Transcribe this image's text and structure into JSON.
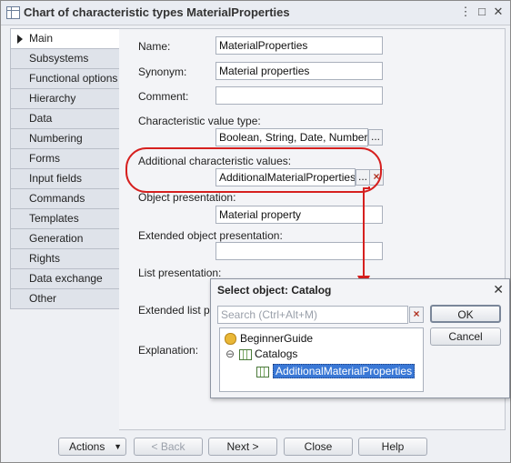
{
  "window": {
    "title": "Chart of characteristic types MaterialProperties",
    "controls": [
      "⋮",
      "□",
      "✕"
    ]
  },
  "tabs": [
    {
      "label": "Main",
      "active": true
    },
    {
      "label": "Subsystems"
    },
    {
      "label": "Functional options"
    },
    {
      "label": "Hierarchy"
    },
    {
      "label": "Data"
    },
    {
      "label": "Numbering"
    },
    {
      "label": "Forms"
    },
    {
      "label": "Input fields"
    },
    {
      "label": "Commands"
    },
    {
      "label": "Templates"
    },
    {
      "label": "Generation"
    },
    {
      "label": "Rights"
    },
    {
      "label": "Data exchange"
    },
    {
      "label": "Other"
    }
  ],
  "form": {
    "name_label": "Name:",
    "name_value": "MaterialProperties",
    "synonym_label": "Synonym:",
    "synonym_value": "Material properties",
    "comment_label": "Comment:",
    "comment_value": "",
    "value_type_label": "Characteristic value type:",
    "value_type_value": "Boolean, String, Date, Number, Cat",
    "additional_label": "Additional characteristic values:",
    "additional_value": "AdditionalMaterialProperties",
    "object_presentation_label": "Object presentation:",
    "object_presentation_value": "Material property",
    "extended_object_label": "Extended object presentation:",
    "extended_object_value": "",
    "list_presentation_label": "List presentation:",
    "extended_list_label": "Extended list pre",
    "explanation_label": "Explanation:",
    "ellipsis": "...",
    "clear": "×"
  },
  "bottom": {
    "actions": "Actions",
    "back": "< Back",
    "next": "Next >",
    "close": "Close",
    "help": "Help"
  },
  "dialog": {
    "title": "Select object: Catalog",
    "close": "✕",
    "search_placeholder": "Search (Ctrl+Alt+M)",
    "ok": "OK",
    "cancel": "Cancel",
    "tree": {
      "root": "BeginnerGuide",
      "group": "Catalogs",
      "group_toggle": "⊖",
      "item": "AdditionalMaterialProperties"
    }
  },
  "colors": {
    "highlight": "#d6201f",
    "selection": "#3a78d6"
  }
}
